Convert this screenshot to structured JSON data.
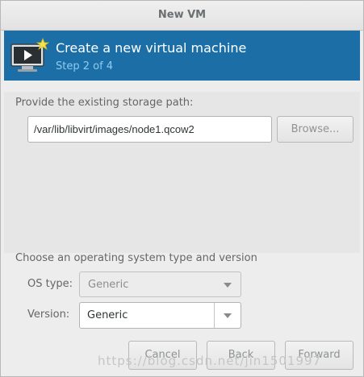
{
  "window": {
    "title": "New VM"
  },
  "banner": {
    "title": "Create a new virtual machine",
    "step": "Step 2 of 4",
    "icon": "virtual-machine-monitor-icon"
  },
  "storage": {
    "label": "Provide the existing storage path:",
    "path_value": "/var/lib/libvirt/images/node1.qcow2",
    "browse_label": "Browse..."
  },
  "os": {
    "section_label": "Choose an operating system type and version",
    "type_label": "OS type:",
    "type_value": "Generic",
    "version_label": "Version:",
    "version_value": "Generic"
  },
  "footer": {
    "cancel_label": "Cancel",
    "back_label": "Back",
    "forward_label": "Forward"
  },
  "watermark": "https://blog.csdn.net/jin1501997",
  "colors": {
    "banner_bg": "#1b6fa6",
    "banner_step": "#8ecbf2",
    "window_bg": "#ededed"
  }
}
